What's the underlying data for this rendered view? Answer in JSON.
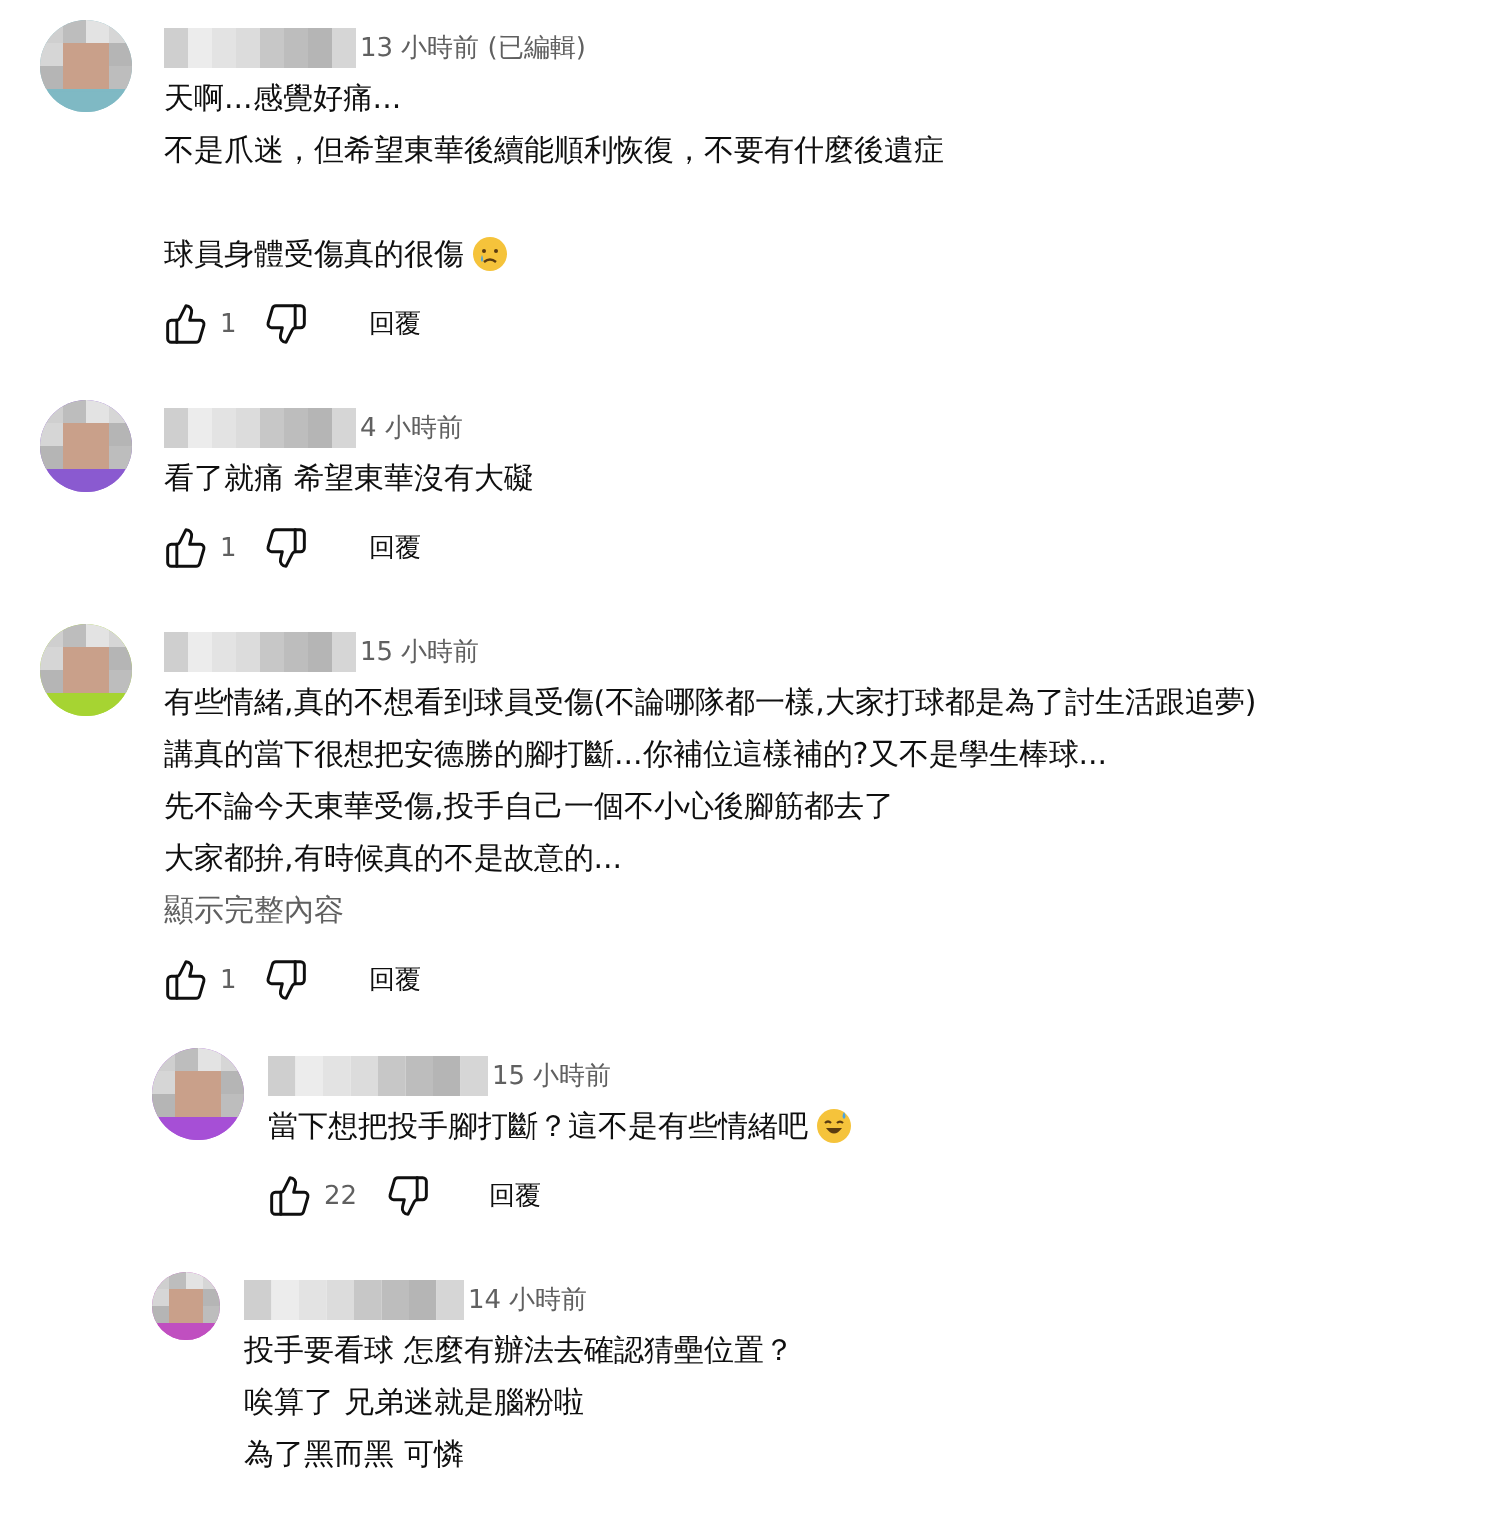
{
  "comments": [
    {
      "time": "13 小時前 (已編輯)",
      "paragraphs": [
        [
          "天啊...感覺好痛...",
          "不是爪迷，但希望東華後續能順利恢復，不要有什麼後遺症"
        ],
        [
          "球員身體受傷真的很傷"
        ]
      ],
      "end_emoji": {
        "kind": "crying"
      },
      "likes": "1",
      "reply_label": "回覆"
    },
    {
      "time": "4 小時前",
      "paragraphs": [
        [
          "看了就痛 希望東華沒有大礙"
        ]
      ],
      "likes": "1",
      "reply_label": "回覆"
    },
    {
      "time": "15 小時前",
      "paragraphs": [
        [
          "有些情緒,真的不想看到球員受傷(不論哪隊都一樣,大家打球都是為了討生活跟追夢)",
          "講真的當下很想把安德勝的腳打斷...你補位這樣補的?又不是學生棒球...",
          "先不論今天東華受傷,投手自己一個不小心後腳筋都去了",
          "大家都拚,有時候真的不是故意的..."
        ]
      ],
      "show_more": "顯示完整內容",
      "likes": "1",
      "reply_label": "回覆",
      "replies": [
        {
          "time": "15 小時前",
          "paragraphs": [
            [
              "當下想把投手腳打斷？這不是有些情緒吧"
            ]
          ],
          "end_emoji": {
            "kind": "sweat"
          },
          "likes": "22",
          "reply_label": "回覆"
        },
        {
          "time": "14 小時前",
          "paragraphs": [
            [
              "投手要看球 怎麼有辦法去確認猜壘位置？",
              "唉算了 兄弟迷就是腦粉啦",
              "為了黑而黑 可憐"
            ]
          ]
        }
      ]
    }
  ]
}
